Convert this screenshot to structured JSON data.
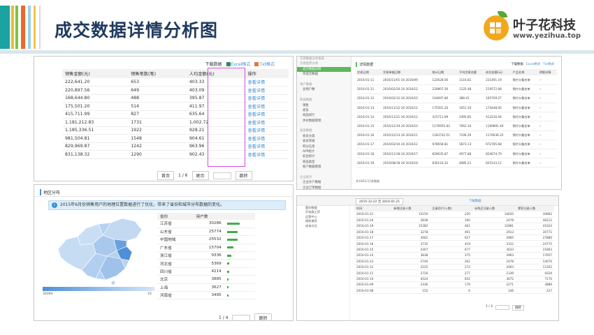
{
  "slide_title": "成交数据详情分析图",
  "brand": {
    "name": "叶子花科技",
    "url": "www.yezihua.top",
    "colors": {
      "orange": "#f2a81a",
      "green": "#52a936",
      "title": "#1f3a5f",
      "accent_pink": "#d24ce0"
    }
  },
  "panel1": {
    "download_label": "下载数据",
    "excel_label": "Excel格式",
    "txt_label": "Txt格式",
    "headers": [
      "销售金额(元)",
      "销售笔数(笔)",
      "人均金额(元)",
      "操作"
    ],
    "op_label": "查看详情",
    "rows": [
      [
        "222,641.20",
        "653",
        "403.33"
      ],
      [
        "220,897.56",
        "649",
        "403.09"
      ],
      [
        "168,644.80",
        "488",
        "395.87"
      ],
      [
        "175,501.20",
        "514",
        "411.97"
      ],
      [
        "415,711.99",
        "827",
        "635.64"
      ],
      [
        "1,181,212.83",
        "1731",
        "1,002.72"
      ],
      [
        "1,185,336.51",
        "1922",
        "928.21"
      ],
      [
        "981,504.81",
        "1548",
        "904.61"
      ],
      [
        "829,969.87",
        "1242",
        "963.96"
      ],
      [
        "831,138.32",
        "1290",
        "902.43"
      ]
    ],
    "pager": {
      "first": "首页",
      "page": "1 / 6",
      "last": "尾页",
      "jump": "跳转"
    }
  },
  "panel2": {
    "title": "详情数据",
    "download_label": "下载数据",
    "excel_label": "Excel格式",
    "txt_label": "Txt格式",
    "sidebar": [
      {
        "label": "交易数据分析报表",
        "type": "grp"
      },
      {
        "label": "交易趋势分析",
        "type": "grp"
      },
      {
        "label": "成交数据详情",
        "type": "act"
      },
      {
        "label": "月成交数据",
        "type": "item"
      },
      {
        "label": "",
        "type": "item"
      },
      {
        "label": "用户数据",
        "type": "grp"
      },
      {
        "label": "总用户数",
        "type": "item"
      },
      {
        "label": "",
        "type": "item"
      },
      {
        "label": "商品数据",
        "type": "grp"
      },
      {
        "label": "销售",
        "type": "item"
      },
      {
        "label": "退货",
        "type": "item"
      },
      {
        "label": "商品排行",
        "type": "item"
      },
      {
        "label": "评价数据管理",
        "type": "item"
      },
      {
        "label": "",
        "type": "item"
      },
      {
        "label": "会员数据",
        "type": "grp"
      },
      {
        "label": "会员分类",
        "type": "item"
      },
      {
        "label": "会员等级",
        "type": "item"
      },
      {
        "label": "积分信息",
        "type": "item"
      },
      {
        "label": "APP统计",
        "type": "item"
      },
      {
        "label": "前台统计",
        "type": "item"
      },
      {
        "label": "商品类型",
        "type": "item"
      },
      {
        "label": "客户数据管理",
        "type": "item"
      },
      {
        "label": "",
        "type": "item"
      },
      {
        "label": "企业统计",
        "type": "grp"
      },
      {
        "label": "企业开户数据",
        "type": "item"
      },
      {
        "label": "企业订单数据",
        "type": "item"
      }
    ],
    "headers": [
      "交易日期",
      "交易单据日期",
      "统计日期",
      "平均交易金额",
      "成功金额(元)",
      "产品名称",
      "明细详情"
    ],
    "rows": [
      [
        "2016-01-11",
        "2016/11/01-16 2016/09",
        "122628.00",
        "1116.81",
        "221491.19",
        "预付卡集合单",
        "--"
      ],
      [
        "2016-01-11",
        "2016/02/20-16 2016/12",
        "229807.56",
        "1125.48",
        "219572.08",
        "预付卡集合单",
        "--"
      ],
      [
        "2016-01-12",
        "2016/02/12-16 2016/10",
        "164697.80",
        "388.41",
        "165709.27",
        "预付卡集合单",
        "--"
      ],
      [
        "2016-01-13",
        "2016/11/12-16 2016/12",
        "175501.20",
        "1051.20",
        "174448.00",
        "预付卡集合单",
        "--"
      ],
      [
        "2016-01-14",
        "2016/11/21-16 2016/12",
        "415711.99",
        "2495.85",
        "413216.04",
        "预付卡集合单",
        "--"
      ],
      [
        "2016-01-15",
        "2016/12/19-16 2016/10",
        "1176955.83",
        "7062.34",
        "1169891.49",
        "预付卡集合单",
        "--"
      ],
      [
        "2016-01-16",
        "2016/12/13-16 2016/11",
        "1183742.51",
        "7106.26",
        "1176636.25",
        "预付卡集合单",
        "--"
      ],
      [
        "2016-01-17",
        "2016/03/10-16 2016/12",
        "978658.81",
        "5873.13",
        "972785.68",
        "预付卡集合单",
        "--"
      ],
      [
        "2016-01-18",
        "2016/11/18-16 2016/17",
        "829635.87",
        "4977.88",
        "824674.79",
        "预付卡集合单",
        "--"
      ],
      [
        "2016-01-19",
        "2016/08/18-16 2016/18",
        "830124.32",
        "4985.21",
        "825143.11",
        "预付卡集合单",
        "--"
      ]
    ],
    "footer": "共10/61/11条数据"
  },
  "panel3": {
    "title": "地区分布",
    "info": "2015年6月份销售用户的地理位置数据进行了优化，带来了省份和城市分布数据的变化。",
    "legend_min": "30284",
    "legend_max": "10",
    "headers": [
      "省份",
      "用户数"
    ],
    "rows": [
      {
        "name": "江苏省",
        "value": "30286",
        "frac": 1.0
      },
      {
        "name": "山东省",
        "value": "25774",
        "frac": 0.85
      },
      {
        "name": "中国地域",
        "value": "25532",
        "frac": 0.84
      },
      {
        "name": "广东省",
        "value": "15704",
        "frac": 0.52
      },
      {
        "name": "浙江省",
        "value": "9336",
        "frac": 0.31
      },
      {
        "name": "河北省",
        "value": "5369",
        "frac": 0.18
      },
      {
        "name": "四川省",
        "value": "4214",
        "frac": 0.14
      },
      {
        "name": "北京",
        "value": "3885",
        "frac": 0.13
      },
      {
        "name": "上海",
        "value": "3627",
        "frac": 0.12
      },
      {
        "name": "河南省",
        "value": "3495",
        "frac": 0.12
      }
    ],
    "pager": {
      "page": "1 / 4",
      "jump": "跳转"
    }
  },
  "panel4": {
    "date_range": "2015-12-22 至 2016-01-21",
    "download_label": "下载数据",
    "sidebar": [
      "量价数据",
      "开始展工资",
      "运营中心",
      "提取增资",
      "成本对比"
    ],
    "headers": [
      "时间",
      "新增注册人数",
      "注册用户(人数)",
      "未购买注册人数",
      "累积注册人数"
    ],
    "rows": [
      [
        "2016-01-21",
        "15150",
        "220",
        "14620",
        "30962"
      ],
      [
        "2016-01-20",
        "2838",
        "160",
        "2478",
        "46212"
      ],
      [
        "2016-01-19",
        "15382",
        "461",
        "12881",
        "41624"
      ],
      [
        "2016-01-18",
        "3278",
        "461",
        "2913",
        "30771"
      ],
      [
        "2016-01-17",
        "3462",
        "627",
        "2865",
        "27880"
      ],
      [
        "2016-01-16",
        "3735",
        "419",
        "3312",
        "24775"
      ],
      [
        "2016-01-15",
        "4307",
        "677",
        "3633",
        "21863"
      ],
      [
        "2016-01-14",
        "3838",
        "375",
        "3963",
        "17657"
      ],
      [
        "2016-01-13",
        "2740",
        "262",
        "2478",
        "14070"
      ],
      [
        "2016-01-12",
        "2225",
        "272",
        "2063",
        "11262"
      ],
      [
        "2016-01-11",
        "2726",
        "277",
        "2339",
        "9329"
      ],
      [
        "2016-01-10",
        "4524",
        "652",
        "3672",
        "7170"
      ],
      [
        "2016-01-09",
        "2330",
        "179",
        "2271",
        "3886"
      ],
      [
        "2016-01-08",
        "152",
        "6",
        "146",
        "227"
      ]
    ],
    "pager": {
      "page": "1 / 3",
      "jump": "跳转"
    }
  }
}
